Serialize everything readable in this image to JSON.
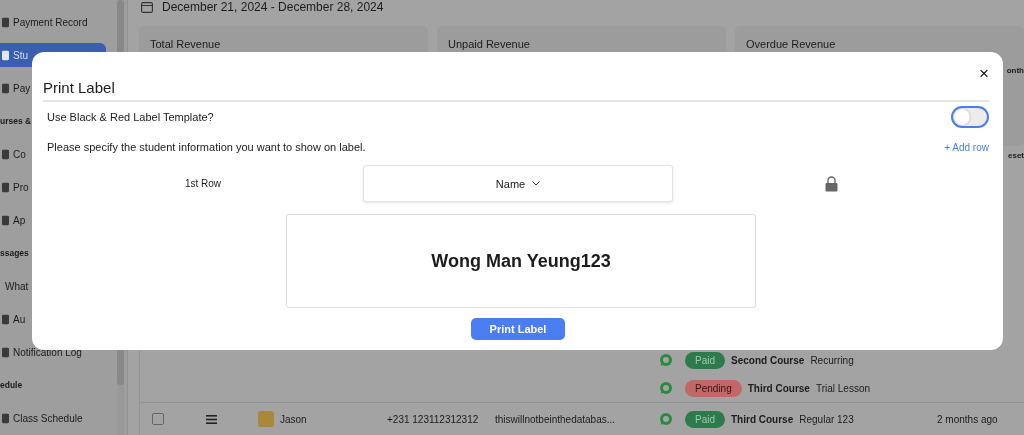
{
  "sidebar": {
    "items": [
      {
        "kind": "item",
        "label": "Payment Record",
        "selected": false
      },
      {
        "kind": "item",
        "label": "Stu",
        "selected": true
      },
      {
        "kind": "item",
        "label": "Pay",
        "selected": false
      },
      {
        "kind": "section",
        "label": "urses &"
      },
      {
        "kind": "item",
        "label": "Co",
        "selected": false
      },
      {
        "kind": "item",
        "label": "Pro",
        "selected": false
      },
      {
        "kind": "item",
        "label": "Ap",
        "selected": false
      },
      {
        "kind": "section",
        "label": "ssages"
      },
      {
        "kind": "plain",
        "label": "What",
        "selected": false
      },
      {
        "kind": "item",
        "label": "Au",
        "selected": false
      },
      {
        "kind": "item",
        "label": "Notification Log",
        "selected": false
      },
      {
        "kind": "section",
        "label": "edule"
      },
      {
        "kind": "item",
        "label": "Class Schedule",
        "selected": false
      }
    ]
  },
  "date_range": "December 21, 2024 - December 28, 2024",
  "cards": [
    {
      "title": "Total Revenue"
    },
    {
      "title": "Unpaid Revenue"
    },
    {
      "title": "Overdue Revenue"
    }
  ],
  "side_labels": [
    "onth",
    "eset"
  ],
  "table": {
    "rows": [
      {
        "kind": "sub",
        "status": {
          "label": "Paid",
          "kind": "paid",
          "color": "#2d7a4c"
        },
        "course": "Second Course",
        "type": "Recurring"
      },
      {
        "kind": "sub",
        "status": {
          "label": "Pending",
          "kind": "pending",
          "color": "#c06868"
        },
        "course": "Third Course",
        "type": "Trial Lesson"
      },
      {
        "kind": "full",
        "checked": false,
        "name": "Jason",
        "phone": "+231 123112312312",
        "email": "thiswillnotbeinthedatabas...",
        "status": {
          "label": "Paid",
          "kind": "paid",
          "color": "#2d7a4c"
        },
        "course": "Third Course",
        "type": "Regular 123",
        "time": "2 months ago"
      }
    ]
  },
  "dialog": {
    "title": "Print Label",
    "close": "×",
    "template_toggle": {
      "label": "Use Black & Red Label Template?",
      "on": false
    },
    "instruction": "Please specify the student information you want to show on label.",
    "add_row": "+ Add row",
    "rows": [
      {
        "label": "1st Row",
        "field": "Name",
        "locked": true
      }
    ],
    "preview": "Wong Man Yeung123",
    "print_button": "Print Label"
  }
}
